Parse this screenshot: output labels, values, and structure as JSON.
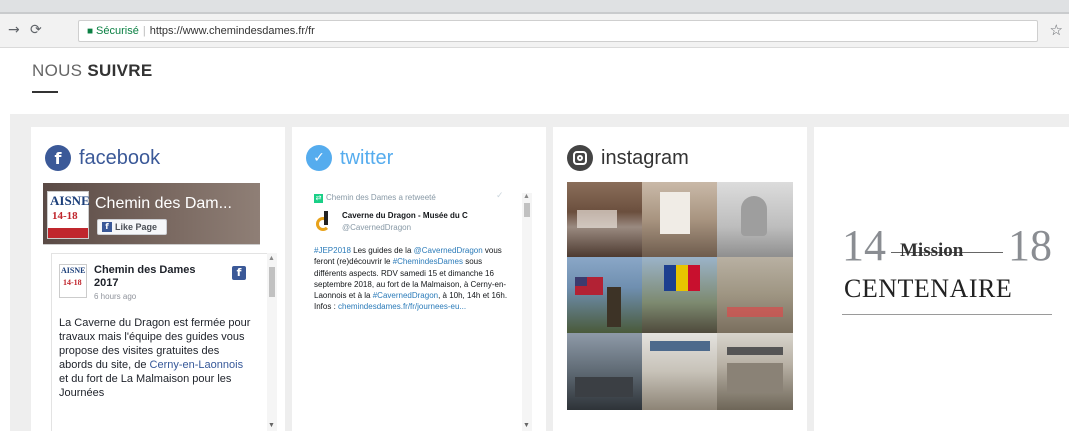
{
  "browser": {
    "secure_label": "Sécurisé",
    "url_prefix": "https://",
    "url_host": "www.chemindesdames.fr",
    "url_suffix": "/fr"
  },
  "section": {
    "title_light": "NOUS",
    "title_bold": "SUIVRE"
  },
  "facebook": {
    "title": "facebook",
    "brand_color": "#3b5998",
    "page_name": "Chemin des Dam...",
    "like_label": "Like Page",
    "logo_text": "AISNE",
    "logo_years": "14-18",
    "post_author": "Chemin des Dames 2017",
    "post_time": "6 hours ago",
    "post_text_1": "La Caverne du Dragon est fermée pour travaux mais l'équipe des guides vous propose des visites gratuites des abords du site, de ",
    "post_link": "Cerny-en-Laonnois",
    "post_text_2": " et du fort de La Malmaison pour les Journées"
  },
  "twitter": {
    "title": "twitter",
    "brand_color": "#55acee",
    "retweet_line": "Chemin des Dames a retweeté",
    "author_name": "Caverne du Dragon - Musée du C",
    "author_handle": "@CavernedDragon",
    "tweet_hashtag": "#JEP2018",
    "tweet_t1": " Les guides de la ",
    "tweet_mention": "@CavernedDragon",
    "tweet_t2": " vous feront (re)découvrir le ",
    "tweet_hashtag2": "#ChemindesDames",
    "tweet_t3": " sous différents aspects. RDV samedi 15 et dimanche 16 septembre 2018, au fort de la Malmaison, à Cerny-en-Laonnois et à la ",
    "tweet_hashtag3": "#CavernedDragon",
    "tweet_t4": ", à 10h, 14h et 16h. Infos : ",
    "tweet_link": "chemindesdames.fr/fr/journees-eu",
    "tweet_t5": "..."
  },
  "instagram": {
    "title": "instagram",
    "icon_color": "#444444"
  },
  "mission": {
    "left_number": "14",
    "word": "Mission",
    "right_number": "18",
    "subtitle": "CENTENAIRE"
  },
  "icons": {
    "back": "arrow-right-icon",
    "reload": "reload-icon",
    "lock": "lock-icon",
    "bookmark": "star-icon"
  }
}
